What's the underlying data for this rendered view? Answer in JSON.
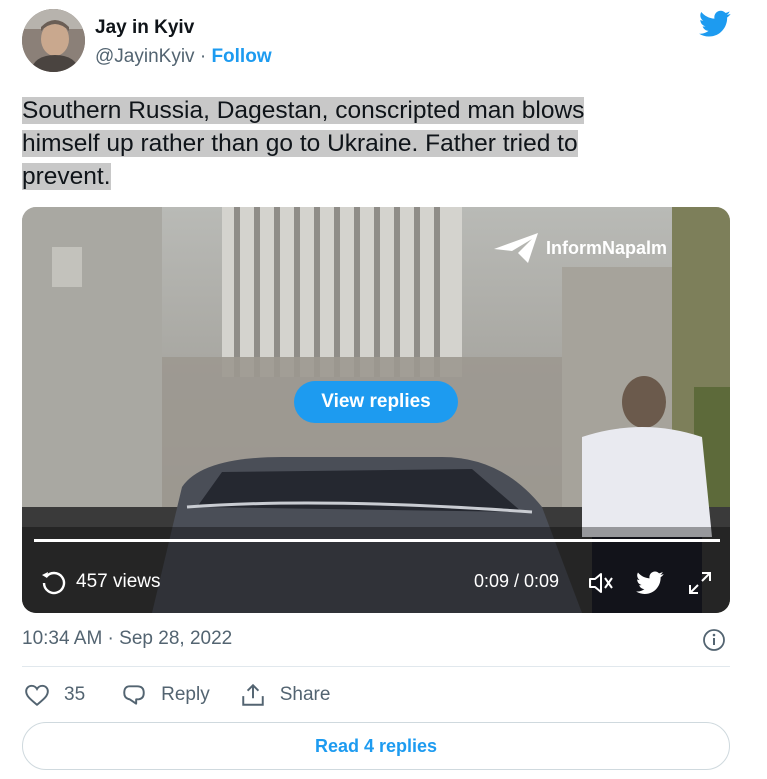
{
  "author": {
    "name": "Jay in Kyiv",
    "handle": "@JayinKyiv",
    "separator": "·",
    "follow_label": "Follow"
  },
  "tweet": {
    "text_lines": [
      "Southern Russia, Dagestan, conscripted man blows",
      "himself up rather than go to Ukraine. Father tried to",
      "prevent."
    ]
  },
  "media": {
    "watermark": "InformNapalm",
    "view_replies_label": "View replies",
    "views": "457 views",
    "time": "0:09 / 0:09",
    "progress_fraction": 1.0
  },
  "timestamp": "10:34 AM · Sep 28, 2022",
  "actions": {
    "like_count": "35",
    "reply_label": "Reply",
    "share_label": "Share"
  },
  "read_replies_label": "Read 4 replies",
  "colors": {
    "accent": "#1d9bf0",
    "text": "#0f1419",
    "secondary": "#536471"
  }
}
